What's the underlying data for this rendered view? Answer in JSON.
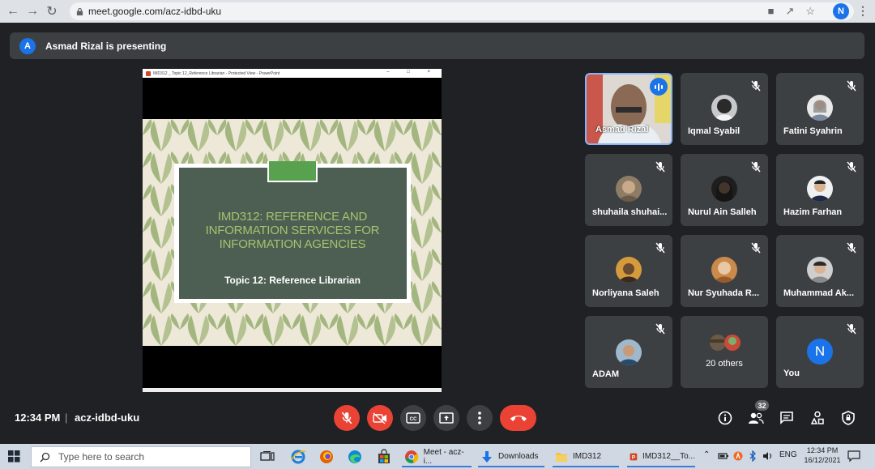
{
  "browser": {
    "url": "meet.google.com/acz-idbd-uku",
    "profile_initial": "N"
  },
  "banner": {
    "initial": "A",
    "text": "Asmad Rizal is presenting"
  },
  "presentation": {
    "window_title": "IMD312 _ Topic 12_Reference Librarian - Protected View - PowerPoint",
    "title": "IMD312: REFERENCE AND INFORMATION SERVICES FOR INFORMATION AGENCIES",
    "subtitle": "Topic 12: Reference Librarian"
  },
  "participants": [
    {
      "name": "Asmad Rizal",
      "muted": false,
      "speaking": true
    },
    {
      "name": "Iqmal Syabil",
      "muted": true
    },
    {
      "name": "Fatini Syahrin",
      "muted": true
    },
    {
      "name": "shuhaila shuhai...",
      "muted": true
    },
    {
      "name": "Nurul Ain Salleh",
      "muted": true
    },
    {
      "name": "Hazim Farhan",
      "muted": true
    },
    {
      "name": "Norliyana Saleh",
      "muted": true
    },
    {
      "name": "Nur Syuhada R...",
      "muted": true
    },
    {
      "name": "Muhammad Ak...",
      "muted": true
    },
    {
      "name": "ADAM",
      "muted": true
    },
    {
      "name": "20 others"
    },
    {
      "name": "You",
      "initial": "N",
      "muted": true
    }
  ],
  "footer": {
    "time": "12:34 PM",
    "separator": "|",
    "meeting_code": "acz-idbd-uku",
    "participant_count": "32"
  },
  "taskbar": {
    "search_placeholder": "Type here to search",
    "apps": {
      "meet": "Meet - acz-i...",
      "downloads": "Downloads",
      "folder": "IMD312",
      "ppt": "IMD312__To..."
    },
    "lang": "ENG",
    "clock_time": "12:34 PM",
    "clock_date": "16/12/2021"
  },
  "colors": {
    "accent": "#1a73e8",
    "danger": "#ea4335",
    "tile_bg": "#3c4043",
    "page_bg": "#202124"
  }
}
